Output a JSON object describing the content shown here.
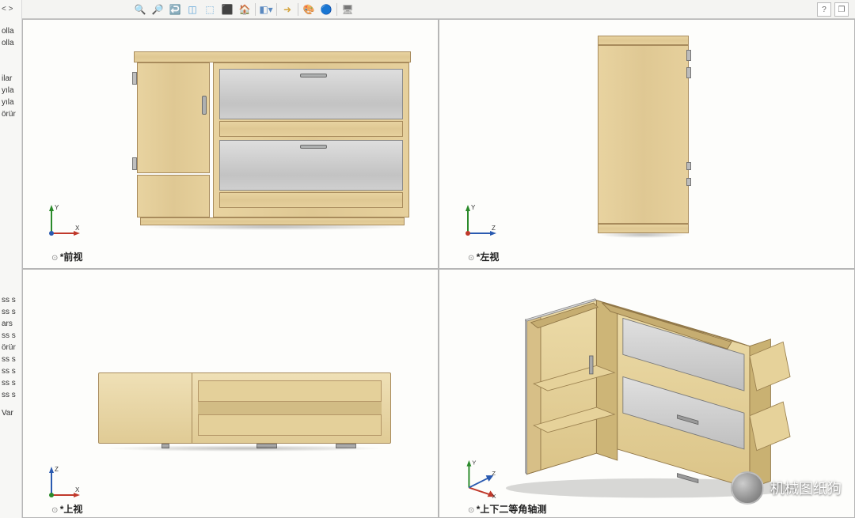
{
  "sidebar": {
    "arrow_left": "<",
    "arrow_right": ">",
    "items": [
      "olla",
      "olla",
      "",
      "ilar",
      "yıla",
      "yıla",
      "örür",
      "",
      "",
      "",
      "",
      "",
      "",
      "ss s",
      "ss s",
      "ars",
      "ss s",
      "örür",
      "ss s",
      "ss s",
      "ss s",
      "ss s",
      "",
      "Var"
    ]
  },
  "toolbar": {
    "icons": [
      "zoom-fit",
      "zoom-area",
      "zoom-prev",
      "section",
      "view-cube",
      "render",
      "scene",
      "display-state",
      "arrow",
      "decal",
      "appearance",
      "paint",
      "monitor"
    ],
    "right": [
      "help",
      "close"
    ]
  },
  "views": {
    "tl": {
      "label": "*前视",
      "eye": "⊙",
      "triad": {
        "up": "Y",
        "right": "X",
        "origin": "green-red"
      }
    },
    "tr": {
      "label": "*左视",
      "eye": "⊙",
      "triad": {
        "up": "Y",
        "right": "Z",
        "origin": "green-blue"
      }
    },
    "bl": {
      "label": "*上视",
      "eye": "⊙",
      "triad": {
        "up": "Z",
        "right": "X",
        "origin": "blue-red"
      }
    },
    "br": {
      "label": "*上下二等角轴测",
      "eye": "⊙",
      "triad": {
        "xyz": true
      }
    }
  },
  "watermark": {
    "text": "机械图纸狗",
    "platform": "wechat"
  }
}
